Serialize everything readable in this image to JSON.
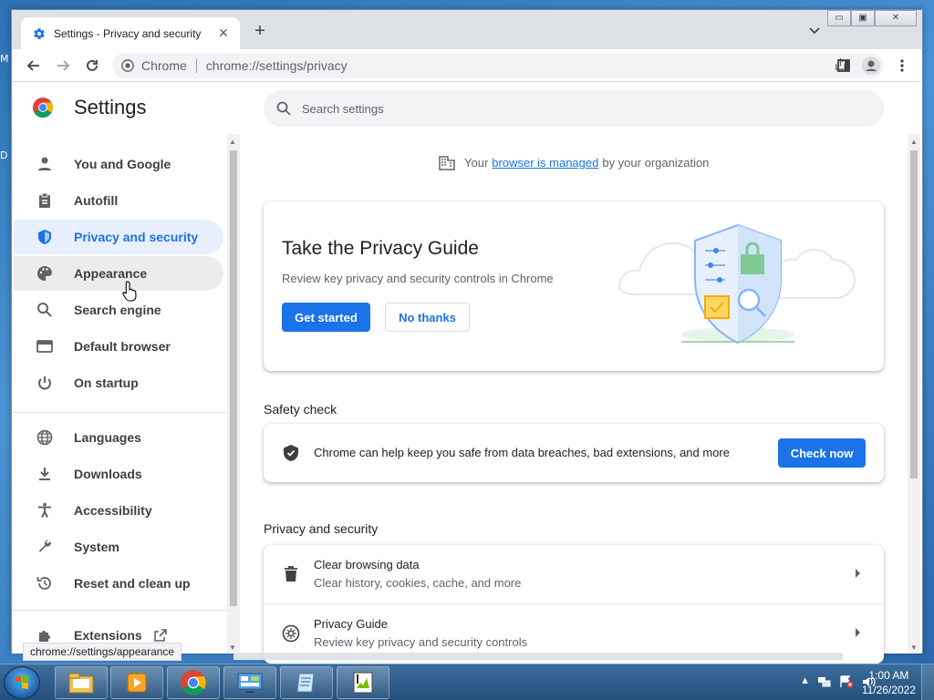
{
  "desktop": {
    "edge_labels": [
      "M",
      "D"
    ]
  },
  "tab": {
    "title": "Settings - Privacy and security"
  },
  "window_controls": {
    "minimize": "▭",
    "maximize": "▣",
    "close": "✕"
  },
  "toolbar": {
    "site_label": "Chrome",
    "url": "chrome://settings/privacy"
  },
  "settings": {
    "title": "Settings",
    "search_placeholder": "Search settings"
  },
  "sidebar": {
    "items": [
      {
        "label": "You and Google",
        "icon": "person-icon"
      },
      {
        "label": "Autofill",
        "icon": "clipboard-icon"
      },
      {
        "label": "Privacy and security",
        "icon": "shield-icon",
        "active": true
      },
      {
        "label": "Appearance",
        "icon": "palette-icon",
        "hover": true
      },
      {
        "label": "Search engine",
        "icon": "search-icon"
      },
      {
        "label": "Default browser",
        "icon": "browser-window-icon"
      },
      {
        "label": "On startup",
        "icon": "power-icon"
      },
      {
        "label": "Languages",
        "icon": "globe-icon"
      },
      {
        "label": "Downloads",
        "icon": "download-icon"
      },
      {
        "label": "Accessibility",
        "icon": "accessibility-icon"
      },
      {
        "label": "System",
        "icon": "wrench-icon"
      },
      {
        "label": "Reset and clean up",
        "icon": "restore-icon"
      },
      {
        "label": "Extensions",
        "icon": "puzzle-icon"
      }
    ]
  },
  "managed": {
    "prefix": "Your",
    "link": "browser is managed",
    "suffix": "by your organization"
  },
  "privacy_guide_card": {
    "title": "Take the Privacy Guide",
    "description": "Review key privacy and security controls in Chrome",
    "primary_button": "Get started",
    "secondary_button": "No thanks"
  },
  "safety_check": {
    "heading": "Safety check",
    "text": "Chrome can help keep you safe from data breaches, bad extensions, and more",
    "button": "Check now"
  },
  "privacy_section": {
    "heading": "Privacy and security",
    "rows": [
      {
        "title": "Clear browsing data",
        "subtitle": "Clear history, cookies, cache, and more",
        "icon": "trash-icon"
      },
      {
        "title": "Privacy Guide",
        "subtitle": "Review key privacy and security controls",
        "icon": "compass-icon"
      }
    ]
  },
  "status_url": "chrome://settings/appearance",
  "taskbar": {
    "time": "1:00 AM",
    "date": "11/26/2022",
    "pinned": [
      "file-explorer-icon",
      "media-player-icon",
      "chrome-icon",
      "control-panel-icon",
      "notepad-icon",
      "paint-icon"
    ]
  },
  "colors": {
    "accent": "#1a73e8",
    "active_nav_bg": "#e8f0fe",
    "text_primary": "#202124",
    "text_secondary": "#5f6368"
  }
}
